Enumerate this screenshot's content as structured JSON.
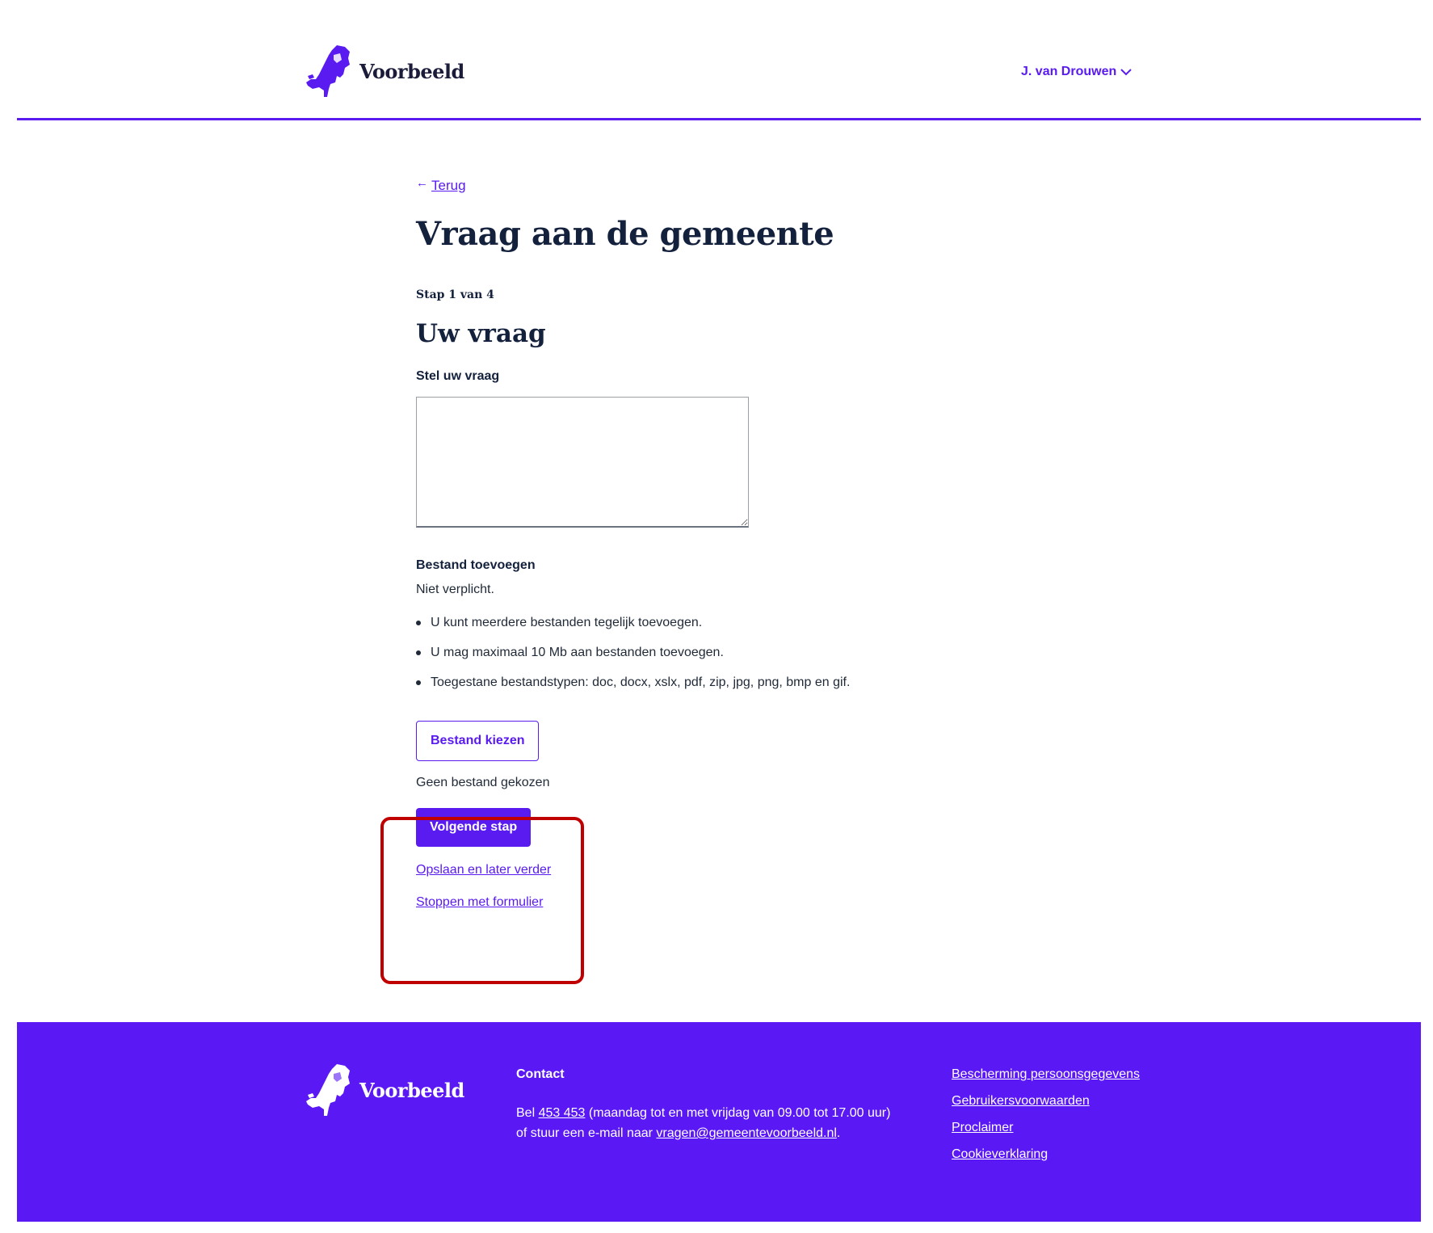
{
  "header": {
    "logo_text": "Voorbeeld",
    "user_name": "J. van Drouwen"
  },
  "main": {
    "back_label": "Terug",
    "back_arrow": "←",
    "title": "Vraag aan de gemeente",
    "step": "Stap 1 van 4",
    "section_title": "Uw vraag",
    "question_label": "Stel uw vraag",
    "question_value": "",
    "file_label": "Bestand toevoegen",
    "file_hint": "Niet verplicht.",
    "file_rules": [
      "U kunt meerdere bestanden tegelijk toevoegen.",
      "U mag maximaal 10 Mb aan bestanden toevoegen.",
      "Toegestane bestandstypen: doc, docx, xslx, pdf, zip, jpg, png, bmp en gif."
    ],
    "file_button": "Bestand kiezen",
    "no_file": "Geen bestand gekozen",
    "next_button": "Volgende stap",
    "save_link": "Opslaan en later verder",
    "stop_link": "Stoppen met formulier"
  },
  "footer": {
    "logo_text": "Voorbeeld",
    "contact_title": "Contact",
    "contact_pre": "Bel ",
    "contact_phone": "453 453",
    "contact_mid": " (maandag tot en met vrijdag van 09.00 tot 17.00 uur) of stuur een e-mail naar ",
    "contact_email": "vragen@gemeentevoorbeeld.nl",
    "contact_post": ".",
    "links": [
      "Bescherming persoonsgegevens",
      "Gebruikersvoorwaarden",
      "Proclaimer",
      "Cookieverklaring"
    ]
  },
  "colors": {
    "brand": "#5a1bf0",
    "highlight": "#c00000",
    "heading": "#14213d"
  },
  "icons": {
    "logo": "netherlands-map-icon",
    "user_menu": "chevron-down-icon",
    "back": "arrow-left-icon"
  }
}
